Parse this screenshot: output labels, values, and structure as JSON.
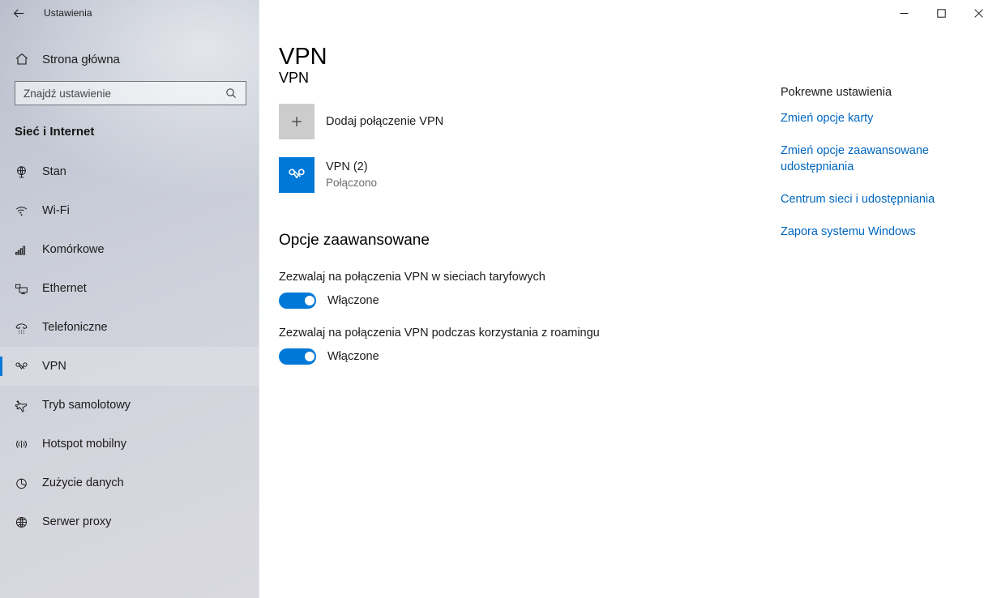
{
  "window": {
    "title": "Ustawienia",
    "back_icon": "back-arrow-icon",
    "minimize_label": "—",
    "maximize_label": "□",
    "close_label": "✕"
  },
  "sidebar": {
    "home": {
      "label": "Strona główna",
      "icon": "home-icon"
    },
    "search": {
      "placeholder": "Znajdź ustawienie",
      "value": "",
      "icon": "search-icon"
    },
    "section_title": "Sieć i Internet",
    "items": [
      {
        "label": "Stan",
        "icon": "network-status-icon",
        "selected": false
      },
      {
        "label": "Wi-Fi",
        "icon": "wifi-icon",
        "selected": false
      },
      {
        "label": "Komórkowe",
        "icon": "cellular-signal-icon",
        "selected": false
      },
      {
        "label": "Ethernet",
        "icon": "ethernet-icon",
        "selected": false
      },
      {
        "label": "Telefoniczne",
        "icon": "dial-up-phone-icon",
        "selected": false
      },
      {
        "label": "VPN",
        "icon": "vpn-icon",
        "selected": true
      },
      {
        "label": "Tryb samolotowy",
        "icon": "airplane-icon",
        "selected": false
      },
      {
        "label": "Hotspot mobilny",
        "icon": "mobile-hotspot-icon",
        "selected": false
      },
      {
        "label": "Zużycie danych",
        "icon": "data-usage-pie-icon",
        "selected": false
      },
      {
        "label": "Serwer proxy",
        "icon": "globe-icon",
        "selected": false
      }
    ]
  },
  "main": {
    "page_title": "VPN",
    "vpn_group_heading": "VPN",
    "add_vpn": {
      "label": "Dodaj połączenie VPN",
      "icon": "plus-icon"
    },
    "connections": [
      {
        "name": "VPN (2)",
        "status": "Połączono",
        "icon": "vpn-connection-icon"
      }
    ],
    "advanced": {
      "title": "Opcje zaawansowane",
      "settings": [
        {
          "label": "Zezwalaj na połączenia VPN w sieciach taryfowych",
          "toggle_state": "Włączone",
          "on": true
        },
        {
          "label": "Zezwalaj na połączenia VPN podczas korzystania z roamingu",
          "toggle_state": "Włączone",
          "on": true
        }
      ]
    }
  },
  "related": {
    "title": "Pokrewne ustawienia",
    "links": [
      "Zmień opcje karty",
      "Zmień opcje zaawansowane udostępniania",
      "Centrum sieci i udostępniania",
      "Zapora systemu Windows"
    ]
  },
  "colors": {
    "accent": "#0078d7",
    "link": "#0067c0",
    "sidebar_top": "#b9bfcc",
    "sidebar_bottom": "#d9d9df",
    "add_tile": "#cccccc",
    "text": "#1b1b1b",
    "muted_text": "#6c6c6c"
  }
}
